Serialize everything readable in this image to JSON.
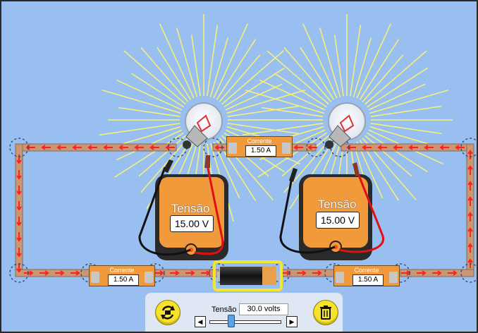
{
  "colors": {
    "background": "#98bff0",
    "wire": "#c99676",
    "current_arrow": "#ff2020",
    "meter_body": "#f09a3c",
    "selection_highlight": "#f2e630",
    "light_rays": "#f5f07a"
  },
  "ammeters": [
    {
      "title": "Corrente",
      "value": "1.50 A"
    },
    {
      "title": "Corrente",
      "value": "1.50 A"
    },
    {
      "title": "Corrente",
      "value": "1.50 A"
    }
  ],
  "voltmeters": [
    {
      "title": "Tensão",
      "value": "15.00 V"
    },
    {
      "title": "Tensão",
      "value": "15.00 V"
    }
  ],
  "control_panel": {
    "voltage_label": "Tensão",
    "voltage_value": "30.0 volts",
    "slider_fraction": 0.3,
    "left_arrow": "◀",
    "right_arrow": "▶",
    "reset_icon": "rotate-icon",
    "delete_icon": "trash-icon"
  }
}
